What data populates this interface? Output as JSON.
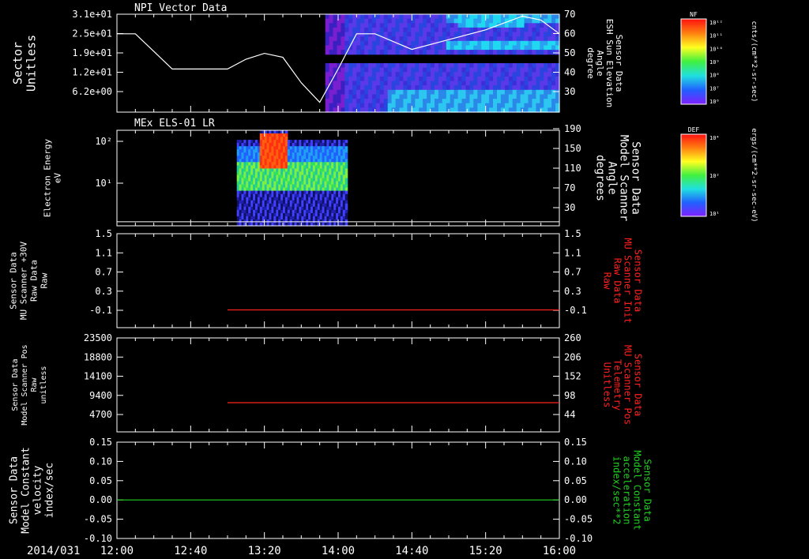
{
  "colors": {
    "background": "#000000",
    "axes": "#ffffff",
    "red_series": "#ff2020",
    "green_series": "#20d020"
  },
  "chart_data": [
    {
      "type": "heatmap",
      "title": "NPI Vector Data",
      "ylabel_left": [
        "Sector",
        "Unitless"
      ],
      "yticks_left": [
        "3.1e+01",
        "2.5e+01",
        "1.9e+01",
        "1.2e+01",
        "6.2e+00"
      ],
      "ylabel_right": [
        "Sensor Data",
        "ESH Sun Elevation",
        "Angle",
        "degree"
      ],
      "yticks_right": [
        "70",
        "60",
        "50",
        "40",
        "30"
      ],
      "ylim_right": [
        20,
        70
      ],
      "line_series": {
        "name": "ESH Sun Elevation Angle",
        "x": [
          "12:00",
          "12:10",
          "12:20",
          "12:30",
          "12:40",
          "12:50",
          "13:00",
          "13:10",
          "13:20",
          "13:30",
          "13:40",
          "13:50",
          "14:00",
          "14:10",
          "14:20",
          "14:40",
          "15:00",
          "15:20",
          "15:40",
          "15:50",
          "16:00"
        ],
        "y": [
          60,
          60,
          51,
          42,
          42,
          42,
          42,
          47,
          50,
          48,
          35,
          25,
          42,
          60,
          60,
          52,
          57,
          62,
          69,
          67,
          60
        ]
      },
      "spectrogram": {
        "start": "13:53",
        "end": "16:00",
        "gaps_ytick": "1.5e+01"
      },
      "colorbar": {
        "label": "NF",
        "units": "cnts/(cm**2-sr-sec)",
        "ticks": [
          "10¹²",
          "10¹¹",
          "10¹⁰",
          "10⁹",
          "10⁸",
          "10⁷",
          "10⁶"
        ]
      }
    },
    {
      "type": "heatmap",
      "title": "MEx ELS-01 LR",
      "ylabel_left": [
        "Electron Energy",
        "eV"
      ],
      "yticks_left": [
        "10²",
        "10¹"
      ],
      "ylabel_right": [
        "Sensor Data",
        "Model Scanner",
        "Angle",
        "degrees"
      ],
      "yticks_right": [
        "190",
        "150",
        "110",
        "70",
        "30"
      ],
      "ylim_right": [
        0,
        190
      ],
      "line_series": {
        "name": "Model Scanner Angle",
        "x": [
          "12:00",
          "16:00"
        ],
        "y": [
          8,
          8
        ]
      },
      "spectrogram": {
        "start": "13:05",
        "end": "14:05"
      },
      "colorbar": {
        "label": "DEF",
        "units": "ergs/(cm**2-sr-sec-eV)",
        "ticks": [
          "10⁴",
          "10²",
          "10¹"
        ]
      }
    },
    {
      "type": "line",
      "ylabel_left": [
        "Sensor Data",
        "MU Scanner +30V",
        "Raw Data",
        "Raw"
      ],
      "yticks_left": [
        "1.5",
        "1.1",
        "0.7",
        "0.3",
        "-0.1"
      ],
      "ylabel_right": [
        "Sensor Data",
        "MU Scanner Init",
        "Raw Data",
        "Raw"
      ],
      "yticks_right": [
        "1.5",
        "1.1",
        "0.7",
        "0.3",
        "-0.1"
      ],
      "ylim": [
        -0.35,
        1.5
      ],
      "series": [
        {
          "name": "MU Scanner Init Raw Data",
          "x": [
            "13:00",
            "16:00"
          ],
          "y": [
            0.0,
            0.0
          ]
        }
      ]
    },
    {
      "type": "line",
      "ylabel_left": [
        "Sensor Data",
        "Model Scanner Pos",
        "Raw",
        "unitless"
      ],
      "yticks_left": [
        "23500",
        "18800",
        "14100",
        "9400",
        "4700"
      ],
      "ylabel_right": [
        "Sensor Data",
        "MU Scanner Pos",
        "Telemetry",
        "Unitless"
      ],
      "yticks_right": [
        "260",
        "206",
        "152",
        "98",
        "44"
      ],
      "ylim": [
        0,
        23500
      ],
      "series": [
        {
          "name": "MU Scanner Pos Telemetry",
          "x": [
            "13:00",
            "16:00"
          ],
          "y": [
            7300,
            7300
          ]
        }
      ]
    },
    {
      "type": "line",
      "ylabel_left": [
        "Sensor Data",
        "Model Constant",
        "velocity",
        "index/sec"
      ],
      "yticks_left": [
        "0.15",
        "0.10",
        "0.05",
        "0.00",
        "-0.05",
        "-0.10"
      ],
      "ylabel_right": [
        "Sensor Data",
        "Model Constant",
        "acceleration",
        "index/sec**2"
      ],
      "yticks_right": [
        "0.15",
        "0.10",
        "0.05",
        "0.00",
        "-0.05",
        "-0.10"
      ],
      "ylim": [
        -0.1,
        0.15
      ],
      "series": [
        {
          "name": "Model Constant",
          "x": [
            "12:00",
            "16:00"
          ],
          "y": [
            0.0,
            0.0
          ]
        }
      ]
    }
  ],
  "x_axis": {
    "date_label": "2014/031",
    "tick_labels": [
      "12:00",
      "12:40",
      "13:20",
      "14:00",
      "14:40",
      "15:20",
      "16:00"
    ],
    "range": [
      "12:00",
      "16:00"
    ]
  }
}
